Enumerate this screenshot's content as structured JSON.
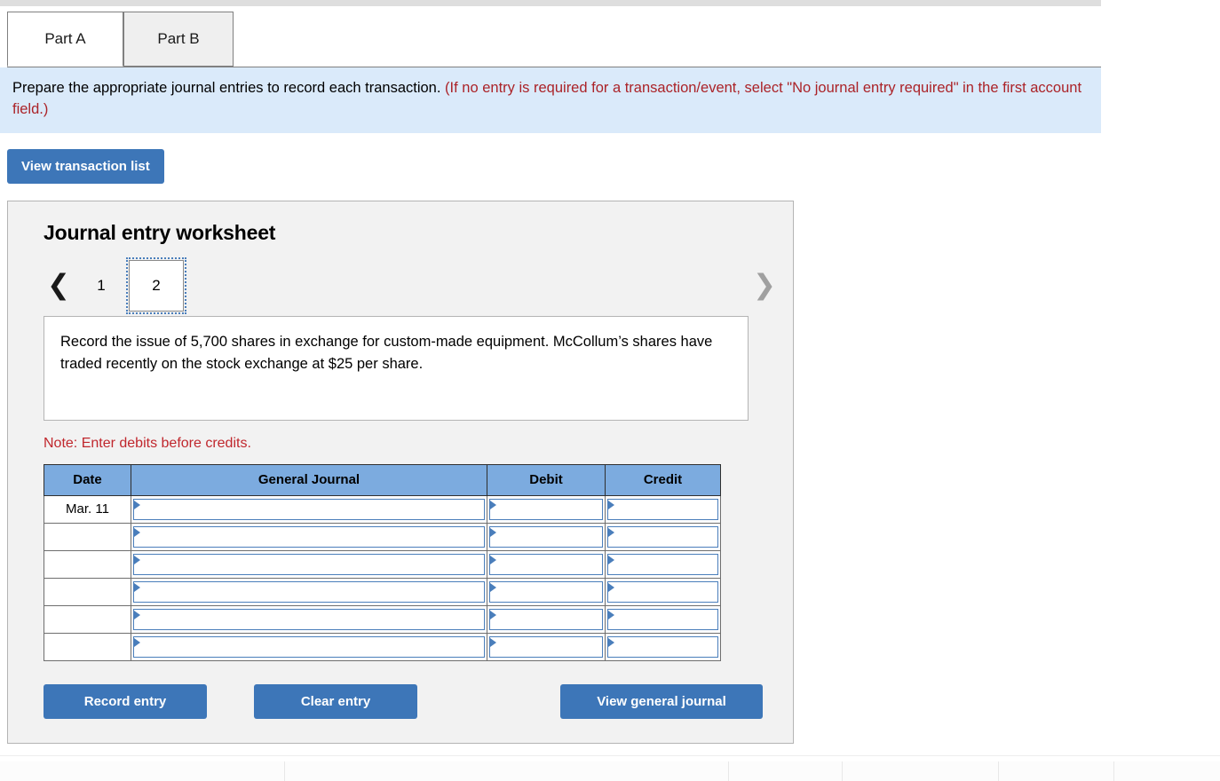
{
  "tabs": [
    {
      "label": "Part A",
      "active": true
    },
    {
      "label": "Part B",
      "active": false
    }
  ],
  "instruction": {
    "main": "Prepare the appropriate journal entries to record each transaction.",
    "hint": "(If no entry is required for a transaction/event, select \"No journal entry required\" in the first account field.)"
  },
  "toolbar": {
    "view_transaction_list": "View transaction list"
  },
  "worksheet": {
    "title": "Journal entry worksheet",
    "pager": {
      "prev_icon": "chevron-left-icon",
      "next_icon": "chevron-right-icon",
      "pages": [
        "1",
        "2"
      ],
      "current": "2"
    },
    "transaction_text": "Record the issue of 5,700 shares in exchange for custom-made equipment. McCollum’s shares have traded recently on the stock exchange at $25 per share.",
    "note": "Note: Enter debits before credits.",
    "table": {
      "headers": [
        "Date",
        "General Journal",
        "Debit",
        "Credit"
      ],
      "rows": [
        {
          "date": "Mar. 11",
          "general_journal": "",
          "debit": "",
          "credit": ""
        },
        {
          "date": "",
          "general_journal": "",
          "debit": "",
          "credit": ""
        },
        {
          "date": "",
          "general_journal": "",
          "debit": "",
          "credit": ""
        },
        {
          "date": "",
          "general_journal": "",
          "debit": "",
          "credit": ""
        },
        {
          "date": "",
          "general_journal": "",
          "debit": "",
          "credit": ""
        },
        {
          "date": "",
          "general_journal": "",
          "debit": "",
          "credit": ""
        }
      ]
    },
    "actions": {
      "record_entry": "Record entry",
      "clear_entry": "Clear entry",
      "view_general_journal": "View general journal"
    }
  },
  "colors": {
    "button_blue": "#3d76b8",
    "header_blue": "#7cabdf",
    "banner_blue": "#daeafa",
    "hint_red": "#ab2328",
    "note_red": "#c0272d",
    "panel_gray": "#f2f2f2"
  }
}
